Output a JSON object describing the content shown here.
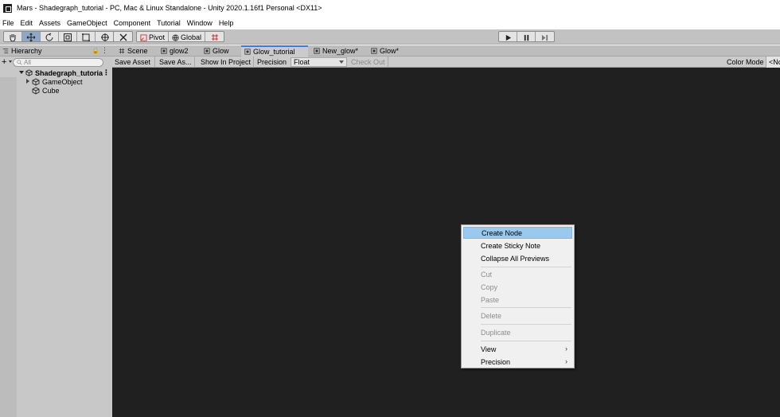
{
  "window": {
    "title": "Mars - Shadegraph_tutorial - PC, Mac & Linux Standalone - Unity 2020.1.16f1 Personal <DX11>"
  },
  "menu": [
    "File",
    "Edit",
    "Assets",
    "GameObject",
    "Component",
    "Tutorial",
    "Window",
    "Help"
  ],
  "toolbar": {
    "pivot_label": "Pivot",
    "global_label": "Global"
  },
  "hierarchy": {
    "tab_label": "Hierarchy",
    "search_placeholder": "All",
    "scene_name": "Shadegraph_tutoria",
    "items": [
      "GameObject",
      "Cube"
    ]
  },
  "editor": {
    "tabs": [
      "Scene",
      "glow2",
      "Glow",
      "Glow_tutorial",
      "New_glow*",
      "Glow*"
    ],
    "active_tab": "Glow_tutorial",
    "toolbar": {
      "save_asset": "Save Asset",
      "save_as": "Save As...",
      "show_in_project": "Show In Project",
      "precision_label": "Precision",
      "precision_value": "Float",
      "check_out": "Check Out",
      "color_mode_label": "Color Mode",
      "color_mode_value": "<No"
    }
  },
  "context_menu": {
    "create_node": "Create Node",
    "create_sticky_note": "Create Sticky Note",
    "collapse_all_previews": "Collapse All Previews",
    "cut": "Cut",
    "copy": "Copy",
    "paste": "Paste",
    "delete": "Delete",
    "duplicate": "Duplicate",
    "view": "View",
    "precision": "Precision"
  },
  "colors": {
    "canvas": "#202020",
    "highlight": "#99c9ef",
    "active_tab_accent": "#3a79d6"
  }
}
